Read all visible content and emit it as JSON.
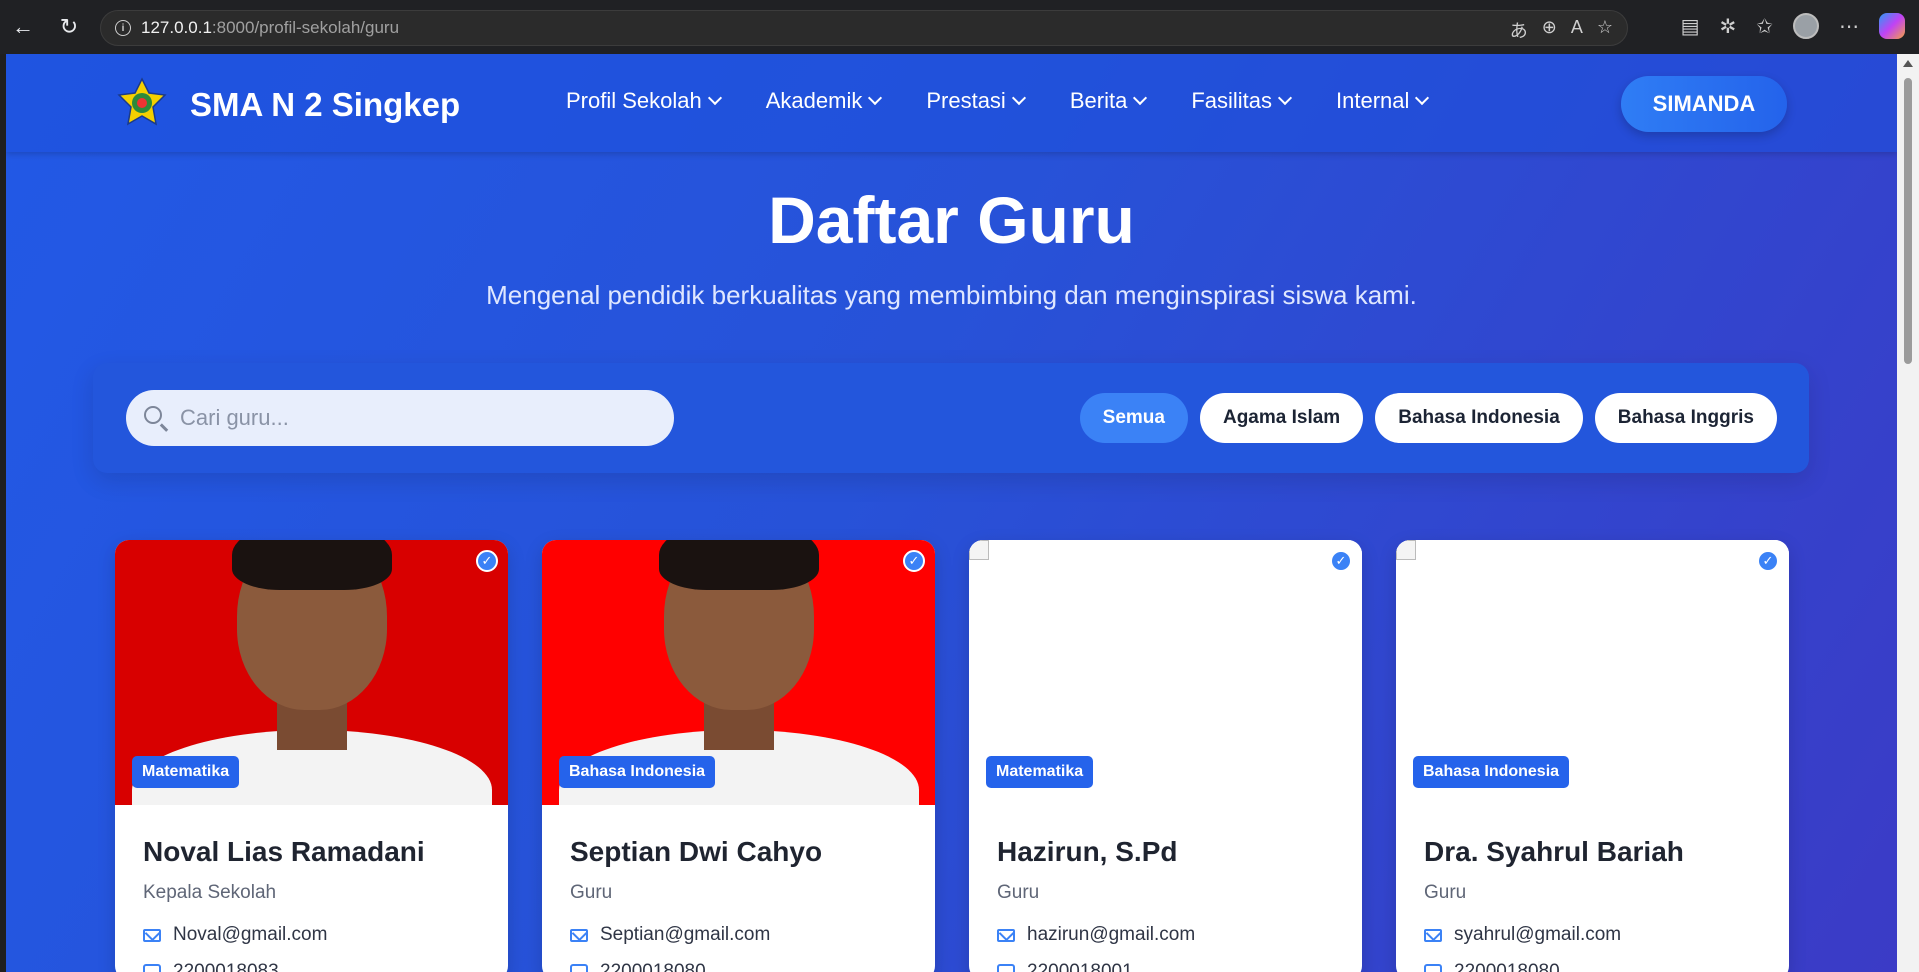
{
  "browser": {
    "url_host": "127.0.0.1",
    "url_path": ":8000/profil-sekolah/guru"
  },
  "header": {
    "brand": "SMA N 2 Singkep",
    "menu": [
      "Profil Sekolah",
      "Akademik",
      "Prestasi",
      "Berita",
      "Fasilitas",
      "Internal"
    ],
    "cta": "SIMANDA"
  },
  "hero": {
    "title": "Daftar Guru",
    "subtitle": "Mengenal pendidik berkualitas yang membimbing dan menginspirasi siswa kami."
  },
  "filters": {
    "search_placeholder": "Cari guru...",
    "chips": [
      "Semua",
      "Agama Islam",
      "Bahasa Indonesia",
      "Bahasa Inggris"
    ],
    "active": "Semua"
  },
  "teachers": [
    {
      "name": "Noval Lias Ramadani",
      "role": "Kepala Sekolah",
      "subject": "Matematika",
      "email": "Noval@gmail.com",
      "id": "2200018083",
      "photo": "red"
    },
    {
      "name": "Septian Dwi Cahyo",
      "role": "Guru",
      "subject": "Bahasa Indonesia",
      "email": "Septian@gmail.com",
      "id": "2200018080",
      "photo": "red2"
    },
    {
      "name": "Hazirun, S.Pd",
      "role": "Guru",
      "subject": "Matematika",
      "email": "hazirun@gmail.com",
      "id": "2200018001",
      "photo": "none"
    },
    {
      "name": "Dra. Syahrul Bariah",
      "role": "Guru",
      "subject": "Bahasa Indonesia",
      "email": "syahrul@gmail.com",
      "id": "2200018080",
      "photo": "none"
    }
  ],
  "colors": {
    "accent": "#2563eb",
    "hero_bg": "#2259e6"
  }
}
